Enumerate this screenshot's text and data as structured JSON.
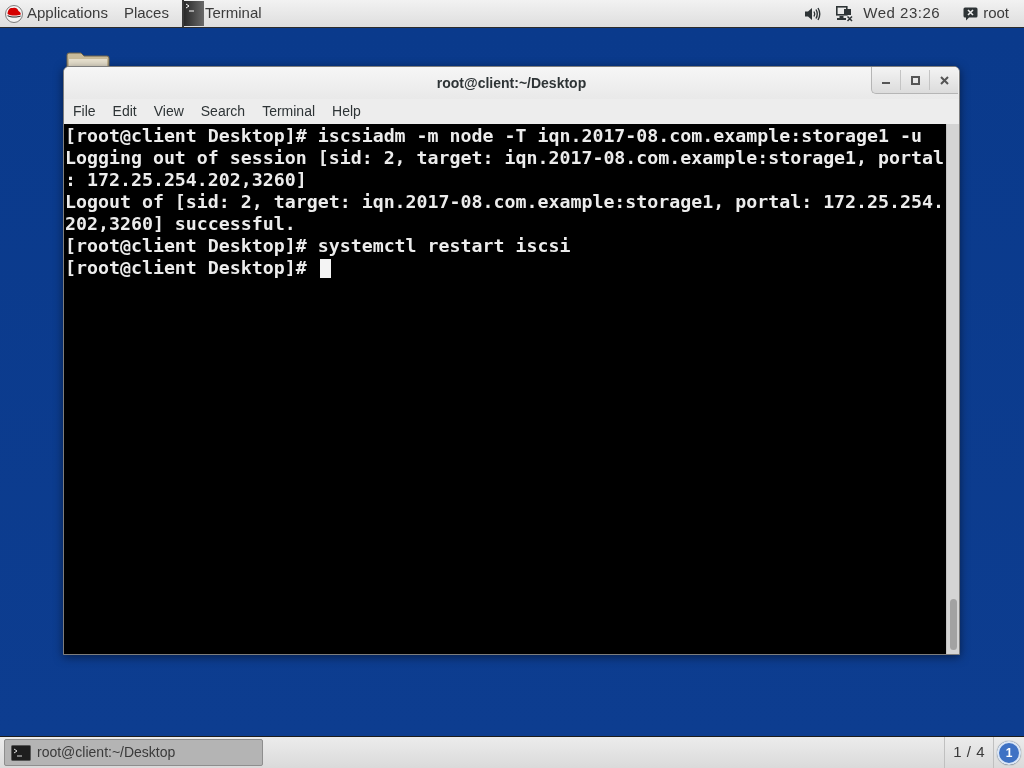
{
  "top_bar": {
    "menus": [
      "Applications",
      "Places"
    ],
    "active_app": "Terminal",
    "clock": "Wed 23:26",
    "user": "root"
  },
  "window": {
    "title": "root@client:~/Desktop",
    "menu": [
      "File",
      "Edit",
      "View",
      "Search",
      "Terminal",
      "Help"
    ],
    "terminal": {
      "lines": [
        "[root@client Desktop]# iscsiadm -m node -T iqn.2017-08.com.example:storage1 -u",
        "Logging out of session [sid: 2, target: iqn.2017-08.com.example:storage1, portal",
        ": 172.25.254.202,3260]",
        "Logout of [sid: 2, target: iqn.2017-08.com.example:storage1, portal: 172.25.254.",
        "202,3260] successful.",
        "[root@client Desktop]# systemctl restart iscsi",
        "[root@client Desktop]#"
      ],
      "cursor_visible": true
    }
  },
  "taskbar": {
    "tasks": [
      {
        "label": "root@client:~/Desktop",
        "selected": true
      }
    ],
    "workspace": "1 / 4",
    "notifications": "1"
  }
}
